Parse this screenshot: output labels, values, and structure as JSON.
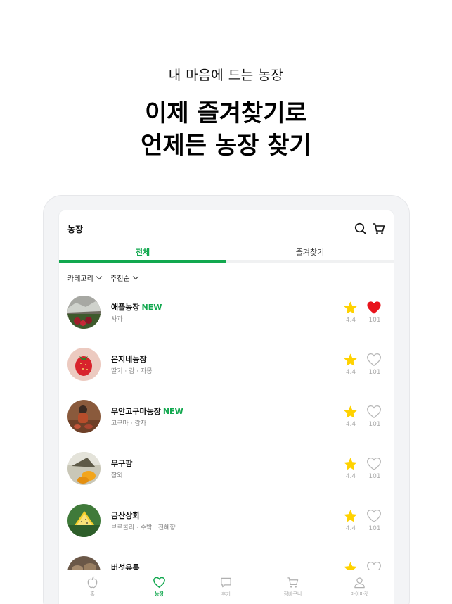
{
  "promo": {
    "subtitle": "내 마음에 드는 농장",
    "title_line1": "이제 즐겨찾기로",
    "title_line2": "언제든 농장 찾기"
  },
  "appbar": {
    "title": "농장",
    "icons": [
      "search-icon",
      "cart-icon"
    ]
  },
  "tabs": [
    {
      "label": "전체",
      "active": true
    },
    {
      "label": "즐겨찾기",
      "active": false
    }
  ],
  "filters": {
    "category": "카테고리",
    "sort": "추천순"
  },
  "farms": [
    {
      "name": "애플농장",
      "badge": "NEW",
      "tags": "사과",
      "rating": "4.4",
      "likes": "101",
      "liked": true
    },
    {
      "name": "은지네농장",
      "badge": "",
      "tags": "딸기 · 감 · 자몽",
      "rating": "4.4",
      "likes": "101",
      "liked": false
    },
    {
      "name": "무안고구마농장",
      "badge": "NEW",
      "tags": "고구마 · 감자",
      "rating": "4.4",
      "likes": "101",
      "liked": false
    },
    {
      "name": "무구팜",
      "badge": "",
      "tags": "참외",
      "rating": "4.4",
      "likes": "101",
      "liked": false
    },
    {
      "name": "금산상회",
      "badge": "",
      "tags": "브로콜리 · 수박 · 천혜향",
      "rating": "4.4",
      "likes": "101",
      "liked": false
    },
    {
      "name": "버섯유통",
      "badge": "",
      "tags": "",
      "rating": "",
      "likes": "",
      "liked": false
    }
  ],
  "bottom_nav": [
    {
      "label": "홈",
      "icon": "apple-icon",
      "active": false
    },
    {
      "label": "농장",
      "icon": "heart-icon",
      "active": true
    },
    {
      "label": "후기",
      "icon": "chat-icon",
      "active": false
    },
    {
      "label": "장바구니",
      "icon": "cart-icon",
      "active": false
    },
    {
      "label": "마이마켓",
      "icon": "user-icon",
      "active": false
    }
  ],
  "colors": {
    "accent": "#12a84f",
    "star": "#ffd200",
    "heart_active": "#e8141c",
    "muted": "#aaaaaa"
  }
}
